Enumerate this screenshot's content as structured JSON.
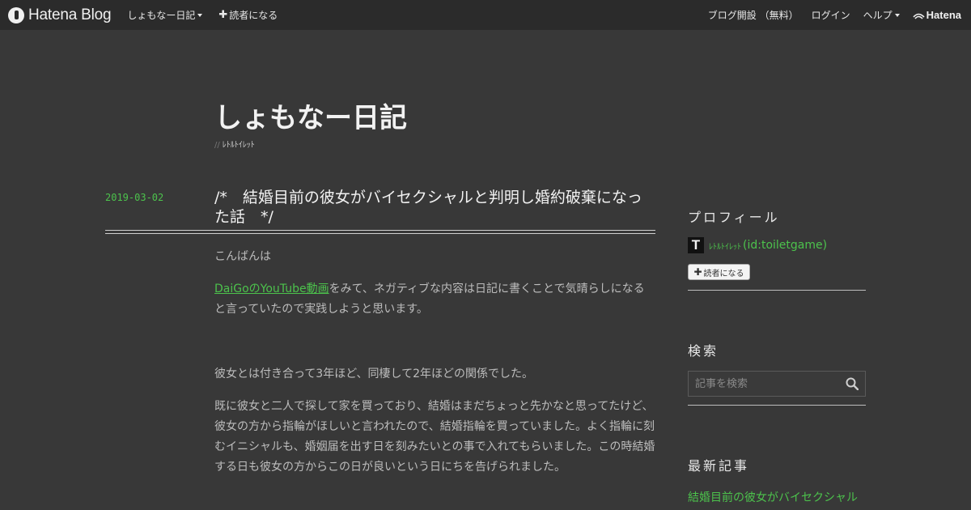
{
  "topbar": {
    "brand": "Hatena Blog",
    "blog_menu": "しょもなー日記",
    "subscribe": "読者になる",
    "open_blog": "ブログ開設 （無料）",
    "login": "ログイン",
    "help": "ヘルプ",
    "hatena": "Hatena"
  },
  "blog": {
    "title": "しょもなー日記",
    "slashes": "//",
    "description": "ﾚﾄﾙﾄｲﾚｯﾄ"
  },
  "entry": {
    "date": "2019-03-02",
    "title": "/*　結婚目前の彼女がバイセクシャルと判明し婚約破棄になった話　*/",
    "p1": "こんばんは",
    "link": "DaiGoのYouTube動画",
    "p2_rest": "をみて、ネガティブな内容は日記に書くことで気晴らしになると言っていたので実践しようと思います。",
    "p3": "彼女とは付き合って3年ほど、同棲して2年ほどの関係でした。",
    "p4": "既に彼女と二人で探して家を買っており、結婚はまだちょっと先かなと思ってたけど、彼女の方から指輪がほしいと言われたので、結婚指輪を買っていました。よく指輪に刻むイニシャルも、婚姻届を出す日を刻みたいとの事で入れてもらいました。この時結婚する日も彼女の方からこの日が良いという日にちを告げられました。"
  },
  "sidebar": {
    "profile_heading": "プロフィール",
    "avatar_letter": "T",
    "profile_name": "ﾚﾄﾙﾄｲﾚｯﾄ",
    "profile_id": "(id:toiletgame)",
    "subscribe_button": "読者になる",
    "search_heading": "検索",
    "search_placeholder": "記事を検索",
    "recent_heading": "最新記事",
    "recent_link": "結婚目前の彼女がバイセクシャル"
  }
}
